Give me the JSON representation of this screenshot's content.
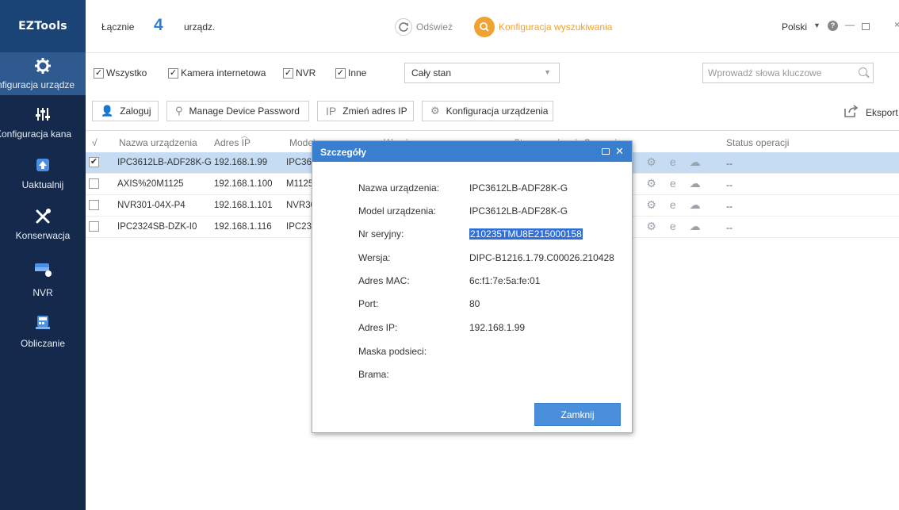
{
  "sidebar": {
    "logo": "EZTools",
    "items": [
      {
        "label": "nfiguracja urządze",
        "icon": "gear-icon"
      },
      {
        "label": "Konfiguracja kana",
        "icon": "sliders-icon"
      },
      {
        "label": "Uaktualnij",
        "icon": "upgrade-icon"
      },
      {
        "label": "Konserwacja",
        "icon": "tools-icon"
      },
      {
        "label": "NVR",
        "icon": "nvr-icon"
      },
      {
        "label": "Obliczanie",
        "icon": "calculator-icon"
      }
    ]
  },
  "header": {
    "total_label": "Łącznie",
    "count": "4",
    "unit": "urządz.",
    "refresh": "Odśwież",
    "search_config": "Konfiguracja wyszukiwania",
    "language": "Polski"
  },
  "filters": {
    "all": "Wszystko",
    "ipc": "Kamera internetowa",
    "nvr": "NVR",
    "other": "Inne",
    "state": "Cały stan",
    "search_placeholder": "Wprowadź słowa kluczowe"
  },
  "toolbar": {
    "login": "Zaloguj",
    "manage_password": "Manage Device Password",
    "change_ip": "Zmień adres IP",
    "device_config": "Konfiguracja urządzenia",
    "export": "Eksport"
  },
  "table": {
    "headers": {
      "check": "√",
      "name": "Nazwa urządzenia",
      "ip": "Adres IP",
      "model": "Model",
      "version": "Wersja",
      "state": "Stan urządzeni",
      "operation": "Operacja",
      "status": "Status operacji"
    },
    "rows": [
      {
        "name": "IPC3612LB-ADF28K-G",
        "ip": "192.168.1.99",
        "model": "IPC361",
        "status": "--",
        "checked": "✔"
      },
      {
        "name": "AXIS%20M1125",
        "ip": "192.168.1.100",
        "model": "M1125",
        "status": "--",
        "checked": ""
      },
      {
        "name": "NVR301-04X-P4",
        "ip": "192.168.1.101",
        "model": "NVR30",
        "status": "--",
        "checked": ""
      },
      {
        "name": "IPC2324SB-DZK-I0",
        "ip": "192.168.1.116",
        "model": "IPC232",
        "status": "--",
        "checked": ""
      }
    ]
  },
  "modal": {
    "title": "Szczegóły",
    "fields": [
      {
        "label": "Nazwa urządzenia:",
        "value": "IPC3612LB-ADF28K-G"
      },
      {
        "label": "Model urządzenia:",
        "value": "IPC3612LB-ADF28K-G"
      },
      {
        "label": "Nr seryjny:",
        "value": "210235TMU8E215000158"
      },
      {
        "label": "Wersja:",
        "value": "DIPC-B1216.1.79.C00026.210428"
      },
      {
        "label": "Adres MAC:",
        "value": "6c:f1:7e:5a:fe:01"
      },
      {
        "label": "Port:",
        "value": "80"
      },
      {
        "label": "Adres IP:",
        "value": "192.168.1.99"
      },
      {
        "label": "Maska podsieci:",
        "value": ""
      },
      {
        "label": "Brama:",
        "value": ""
      }
    ],
    "close": "Zamknij"
  },
  "colors": {
    "sidebar_bg": "#14294b",
    "accent_blue": "#3a7fcf",
    "orange": "#f0a233",
    "selected_row": "#c5dcf3"
  }
}
